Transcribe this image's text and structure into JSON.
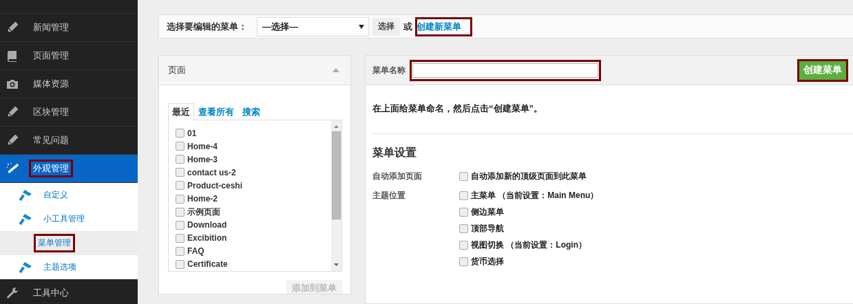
{
  "sidebar": {
    "items": [
      {
        "label": "新闻管理",
        "selected": false,
        "highlighted": false
      },
      {
        "label": "页面管理",
        "selected": false,
        "highlighted": false
      },
      {
        "label": "媒体资源",
        "selected": false,
        "highlighted": false
      },
      {
        "label": "区块管理",
        "selected": false,
        "highlighted": false
      },
      {
        "label": "常见问题",
        "selected": false,
        "highlighted": false
      },
      {
        "label": "外观管理",
        "selected": true,
        "highlighted": true,
        "children": [
          {
            "label": "自定义",
            "selected": false,
            "highlighted": false
          },
          {
            "label": "小工具管理",
            "selected": false,
            "highlighted": false
          },
          {
            "label": "菜单管理",
            "selected": true,
            "highlighted": true
          },
          {
            "label": "主题选项",
            "selected": false,
            "highlighted": false
          }
        ]
      },
      {
        "label": "工具中心",
        "selected": false,
        "highlighted": false
      }
    ]
  },
  "menu_picker": {
    "label": "选择要编辑的菜单：",
    "select_value": "—选择—",
    "button": "选择",
    "or_text": "或",
    "create_link": {
      "label": "创建新菜单",
      "highlighted": true
    }
  },
  "pages_panel": {
    "title": "页面",
    "tabs": [
      {
        "label": "最近",
        "selected": true
      },
      {
        "label": "查看所有",
        "selected": false
      },
      {
        "label": "搜索",
        "selected": false
      }
    ],
    "items": [
      {
        "label": "01",
        "checked": false
      },
      {
        "label": "Home-4",
        "checked": false
      },
      {
        "label": "Home-3",
        "checked": false
      },
      {
        "label": "contact us-2",
        "checked": false
      },
      {
        "label": "Product-ceshi",
        "checked": false
      },
      {
        "label": "Home-2",
        "checked": false
      },
      {
        "label": "示例页面",
        "checked": false
      },
      {
        "label": "Download",
        "checked": false
      },
      {
        "label": "Excibition",
        "checked": false
      },
      {
        "label": "FAQ",
        "checked": false
      },
      {
        "label": "Certificate",
        "checked": false
      }
    ],
    "add_button": {
      "label": "添加到菜单",
      "disabled": true
    }
  },
  "menu_editor": {
    "name_label": "菜单名称",
    "name_field_highlighted": true,
    "create_button": {
      "label": "创建菜单",
      "highlighted": true
    },
    "instruction": "在上面给菜单命名，然后点击“创建菜单”。",
    "settings_title": "菜单设置",
    "settings": [
      {
        "label": "自动添加页面",
        "options": [
          {
            "label": "自动添加新的顶级页面到此菜单",
            "checked": false
          }
        ]
      },
      {
        "label": "主题位置",
        "options": [
          {
            "label": "主菜单 （当前设置：Main Menu）",
            "checked": false
          },
          {
            "label": "侧边菜单",
            "checked": false
          },
          {
            "label": "顶部导航",
            "checked": false
          },
          {
            "label": "视图切换 （当前设置：Login）",
            "checked": false
          },
          {
            "label": "货币选择",
            "checked": false
          }
        ]
      }
    ]
  }
}
